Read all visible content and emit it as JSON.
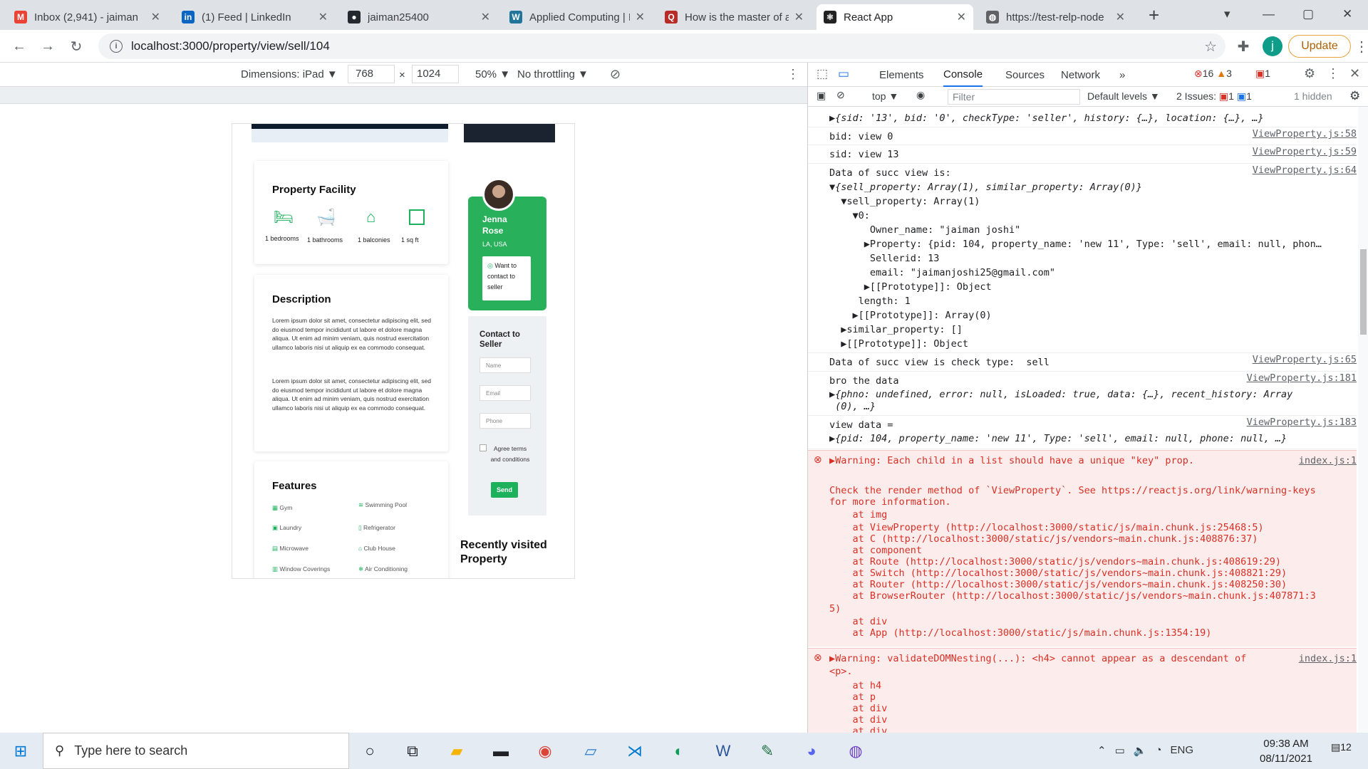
{
  "tabs": [
    {
      "title": "Inbox (2,941) - jaiman",
      "icon": "gmail-icon",
      "color": "#ea4335",
      "glyph": "M"
    },
    {
      "title": "(1) Feed | LinkedIn",
      "icon": "linkedin-icon",
      "color": "#0a66c2",
      "glyph": "in"
    },
    {
      "title": "jaiman25400",
      "icon": "github-icon",
      "color": "#24292f",
      "glyph": "●"
    },
    {
      "title": "Applied Computing | F",
      "icon": "wordpress-icon",
      "color": "#21759b",
      "glyph": "W"
    },
    {
      "title": "How is the master of a",
      "icon": "quora-icon",
      "color": "#b92b27",
      "glyph": "Q"
    },
    {
      "title": "React App",
      "icon": "react-icon",
      "color": "#222",
      "glyph": "⚛"
    },
    {
      "title": "https://test-relp-node",
      "icon": "globe-icon",
      "color": "#5f6368",
      "glyph": "◍"
    }
  ],
  "browser": {
    "url": "localhost:3000/property/view/sell/104",
    "update_label": "Update",
    "profile": "j"
  },
  "device_toolbar": {
    "dimensions": "Dimensions: iPad ▼",
    "width": "768",
    "height": "1024",
    "zoom": "50% ▼",
    "throttle": "No throttling ▼",
    "x": "×"
  },
  "page": {
    "facility_title": "Property Facility",
    "facilities": [
      "1 bedrooms",
      "1 bathrooms",
      "1 balconies",
      "1 sq ft"
    ],
    "agent_name": "Jenna Rose",
    "agent_loc": "LA, USA",
    "whatsapp": "Want to contact to seller",
    "desc_title": "Description",
    "desc_p1": "Lorem ipsum dolor sit amet, consectetur adipiscing elit, sed do eiusmod tempor incididunt ut labore et dolore magna aliqua. Ut enim ad minim veniam, quis nostrud exercitation ullamco laboris nisi ut aliquip ex ea commodo consequat.",
    "desc_p2": "Lorem ipsum dolor sit amet, consectetur adipiscing elit, sed do eiusmod tempor incididunt ut labore et dolore magna aliqua. Ut enim ad minim veniam, quis nostrud exercitation ullamco laboris nisi ut aliquip ex ea commodo consequat.",
    "contact_title": "Contact to Seller",
    "ph_name": "Name",
    "ph_email": "Email",
    "ph_phone": "Phone",
    "agree": "Agree terms and conditions",
    "send": "Send",
    "features_title": "Features",
    "features": [
      "Gym",
      "Swimming Pool",
      "Laundry",
      "Refrigerator",
      "Microwave",
      "Club House",
      "Window Coverings",
      "Air Conditioning"
    ],
    "recent_title": "Recently visited Property"
  },
  "devtools": {
    "tabs": [
      "Elements",
      "Console",
      "Sources",
      "Network",
      "»"
    ],
    "errors": "16",
    "warnings": "3",
    "issues_badge": "1",
    "context": "top ▼",
    "filter": "Filter",
    "levels": "Default levels ▼",
    "issues": "2 Issues:",
    "issue_err": "1",
    "issue_info": "1",
    "hidden": "1 hidden"
  },
  "console": [
    "▶{sid: '13', bid: '0', checkType: 'seller', history: {…}, location: {…}, …}",
    "bid: view 0",
    "sid: view 13",
    "Data of succ view is:",
    "▼{sell_property: Array(1), similar_property: Array(0)}",
    "  ▼sell_property: Array(1)",
    "    ▼0:",
    "       Owner_name: \"jaiman joshi\"",
    "      ▶Property: {pid: 104, property_name: 'new 11', Type: 'sell', email: null, phon…",
    "       Sellerid: 13",
    "       email: \"jaimanjoshi25@gmail.com\"",
    "      ▶[[Prototype]]: Object",
    "     length: 1",
    "    ▶[[Prototype]]: Array(0)",
    "  ▶similar_property: []",
    "  ▶[[Prototype]]: Object",
    "Data of succ view is check type:  sell",
    "bro the data",
    "▶{phno: undefined, error: null, isLoaded: true, data: {…}, recent_history: Array",
    " (0), …}",
    "view data =",
    "▶{pid: 104, property_name: 'new 11', Type: 'sell', email: null, phone: null, …}"
  ],
  "sources": [
    "ViewProperty.js:58",
    "ViewProperty.js:59",
    "ViewProperty.js:64",
    "ViewProperty.js:65",
    "ViewProperty.js:181",
    "ViewProperty.js:183",
    "index.js:1",
    "index.js:1"
  ],
  "warning1": [
    "▶Warning: Each child in a list should have a unique \"key\" prop.",
    "",
    "Check the render method of `ViewProperty`. See https://reactjs.org/link/warning-keys",
    "for more information.",
    "    at img",
    "    at ViewProperty (http://localhost:3000/static/js/main.chunk.js:25468:5)",
    "    at C (http://localhost:3000/static/js/vendors~main.chunk.js:408876:37)",
    "    at component",
    "    at Route (http://localhost:3000/static/js/vendors~main.chunk.js:408619:29)",
    "    at Switch (http://localhost:3000/static/js/vendors~main.chunk.js:408821:29)",
    "    at Router (http://localhost:3000/static/js/vendors~main.chunk.js:408250:30)",
    "    at BrowserRouter (http://localhost:3000/static/js/vendors~main.chunk.js:407871:3",
    "5)",
    "    at div",
    "    at App (http://localhost:3000/static/js/main.chunk.js:1354:19)"
  ],
  "warning2": [
    "▶Warning: validateDOMNesting(...): <h4> cannot appear as a descendant of",
    "<p>.",
    "    at h4",
    "    at p",
    "    at div",
    "    at div",
    "    at div"
  ],
  "taskbar": {
    "search": "Type here to search",
    "time": "09:38 AM",
    "date": "08/11/2021",
    "lang": "ENG",
    "notif": "12"
  }
}
